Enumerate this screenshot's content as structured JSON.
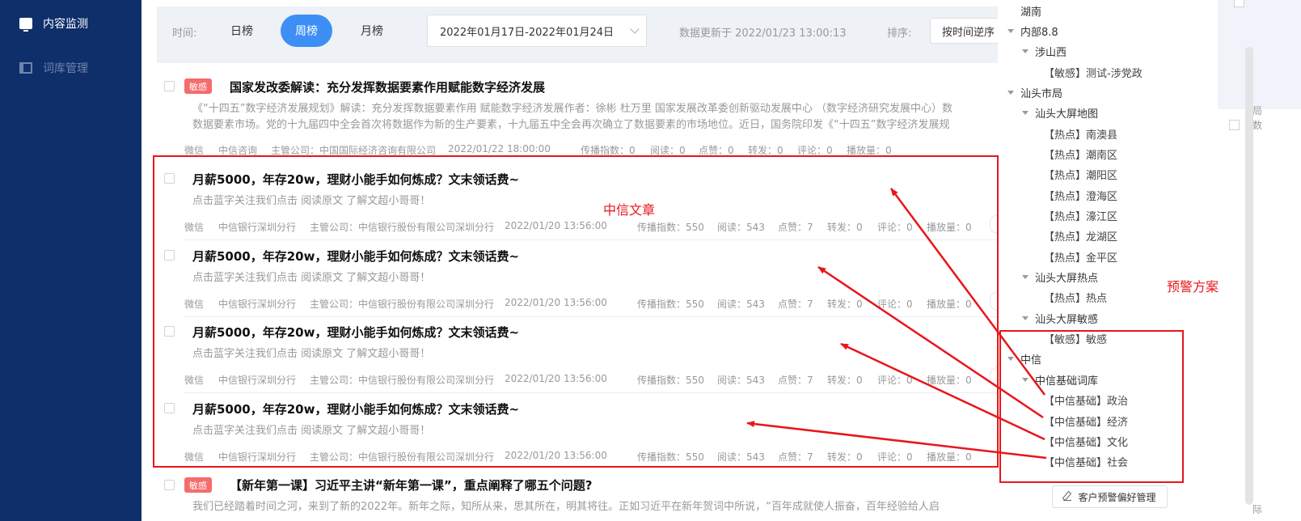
{
  "sidebar": {
    "items": [
      {
        "label": "内容监测",
        "icon": "monitor-icon",
        "active": true
      },
      {
        "label": "词库管理",
        "icon": "book-icon",
        "active": false
      }
    ]
  },
  "filter": {
    "time_label": "时间:",
    "tabs": [
      {
        "label": "日榜",
        "active": false
      },
      {
        "label": "周榜",
        "active": true
      },
      {
        "label": "月榜",
        "active": false
      }
    ],
    "date_range": "2022年01月17日-2022年01月24日",
    "update_text": "数据更新于 2022/01/23 13:00:13",
    "sort_label": "排序:",
    "sort_value": "按时间逆序"
  },
  "articles": [
    {
      "badge": "敏感",
      "title": "国家发改委解读：充分发挥数据要素作用赋能数字经济发展",
      "abstract": [
        "《“十四五”数字经济发展规划》解读：充分发挥数据要素作用 赋能数字经济发展作者：徐彬 杜万里 国家发展改革委创新驱动发展中心 （数字经济研究发展中心）数",
        "数据要素市场。党的十九届四中全会首次将数据作为新的生产要素，十九届五中全会再次确立了数据要素的市场地位。近日，国务院印发《“十四五”数字经济发展规"
      ],
      "meta": {
        "platform": "微信",
        "account": "中信咨询",
        "company": "主管公司：中国国际经济咨询有限公司",
        "time": "2022/01/22 18:00:00",
        "spread": "传播指数：0",
        "read": "阅读：0",
        "like": "点赞：0",
        "forward": "转发：0",
        "comment": "评论：0",
        "play": "播放量：0"
      }
    },
    {
      "title": "月薪5000，年存20w，理财小能手如何炼成？文末领话费~",
      "abstract": [
        "点击蓝字关注我们点击 阅读原文 了解文超小哥哥！"
      ],
      "meta": {
        "platform": "微信",
        "account": "中信银行深圳分行",
        "company": "主管公司：中信银行股份有限公司深圳分行",
        "time": "2022/01/20 13:56:00",
        "spread": "传播指数：550",
        "read": "阅读：543",
        "like": "点赞：7",
        "forward": "转发：0",
        "comment": "评论：0",
        "play": "播放量：0"
      }
    },
    {
      "title": "月薪5000，年存20w，理财小能手如何炼成？文末领话费~",
      "abstract": [
        "点击蓝字关注我们点击 阅读原文 了解文超小哥哥！"
      ],
      "meta": {
        "platform": "微信",
        "account": "中信银行深圳分行",
        "company": "主管公司：中信银行股份有限公司深圳分行",
        "time": "2022/01/20 13:56:00",
        "spread": "传播指数：550",
        "read": "阅读：543",
        "like": "点赞：7",
        "forward": "转发：0",
        "comment": "评论：0",
        "play": "播放量：0"
      }
    },
    {
      "title": "月薪5000，年存20w，理财小能手如何炼成？文末领话费~",
      "abstract": [
        "点击蓝字关注我们点击 阅读原文 了解文超小哥哥！"
      ],
      "meta": {
        "platform": "微信",
        "account": "中信银行深圳分行",
        "company": "主管公司：中信银行股份有限公司深圳分行",
        "time": "2022/01/20 13:56:00",
        "spread": "传播指数：550",
        "read": "阅读：543",
        "like": "点赞：7",
        "forward": "转发：0",
        "comment": "评论：0",
        "play": "播放量：0"
      }
    },
    {
      "title": "月薪5000，年存20w，理财小能手如何炼成？文末领话费~",
      "abstract": [
        "点击蓝字关注我们点击 阅读原文 了解文超小哥哥！"
      ],
      "meta": {
        "platform": "微信",
        "account": "中信银行深圳分行",
        "company": "主管公司：中信银行股份有限公司深圳分行",
        "time": "2022/01/20 13:56:00",
        "spread": "传播指数：550",
        "read": "阅读：543",
        "like": "点赞：7",
        "forward": "转发：0",
        "comment": "评论：0",
        "play": "播放量：0"
      }
    },
    {
      "badge": "敏感",
      "title": "【新年第一课】习近平主讲“新年第一课”，重点阐释了哪五个问题?",
      "abstract": [
        "我们已经踏着时间之河，来到了新的2022年。新年之际，知所从来，思其所在，明其将往。正如习近平在新年贺词中所说，“百年成就使人振奋，百年经验给人启"
      ],
      "meta": null
    }
  ],
  "tree": {
    "nodes": [
      {
        "label": "湖南",
        "level": 0,
        "expanded": null
      },
      {
        "label": "内部8.8",
        "level": 0,
        "expanded": true
      },
      {
        "label": "涉山西",
        "level": 1,
        "expanded": true
      },
      {
        "label": "【敏感】测试-涉党政",
        "level": 2,
        "expanded": null
      },
      {
        "label": "汕头市局",
        "level": 0,
        "expanded": true
      },
      {
        "label": "汕头大屏地图",
        "level": 1,
        "expanded": true
      },
      {
        "label": "【热点】南澳县",
        "level": 2,
        "expanded": null
      },
      {
        "label": "【热点】潮南区",
        "level": 2,
        "expanded": null
      },
      {
        "label": "【热点】潮阳区",
        "level": 2,
        "expanded": null
      },
      {
        "label": "【热点】澄海区",
        "level": 2,
        "expanded": null
      },
      {
        "label": "【热点】濠江区",
        "level": 2,
        "expanded": null
      },
      {
        "label": "【热点】龙湖区",
        "level": 2,
        "expanded": null
      },
      {
        "label": "【热点】金平区",
        "level": 2,
        "expanded": null
      },
      {
        "label": "汕头大屏热点",
        "level": 1,
        "expanded": true
      },
      {
        "label": "【热点】热点",
        "level": 2,
        "expanded": null
      },
      {
        "label": "汕头大屏敏感",
        "level": 1,
        "expanded": true
      },
      {
        "label": "【敏感】敏感",
        "level": 2,
        "expanded": null
      },
      {
        "label": "中信",
        "level": 0,
        "expanded": true
      },
      {
        "label": "中信基础词库",
        "level": 1,
        "expanded": true
      },
      {
        "label": "【中信基础】政治",
        "level": 2,
        "expanded": null
      },
      {
        "label": "【中信基础】经济",
        "level": 2,
        "expanded": null
      },
      {
        "label": "【中信基础】文化",
        "level": 2,
        "expanded": null
      },
      {
        "label": "【中信基础】社会",
        "level": 2,
        "expanded": null
      }
    ],
    "preference_button": "客户预警偏好管理"
  },
  "sliver": {
    "texts": [
      "局",
      "数",
      "际"
    ]
  },
  "annotations": {
    "articles_label": "中信文章",
    "scheme_label": "预警方案",
    "color": "#e8161a"
  },
  "colors": {
    "sidebar": "#0f2f6a",
    "accent": "#3d8ff5",
    "badge": "#f56c6c"
  }
}
